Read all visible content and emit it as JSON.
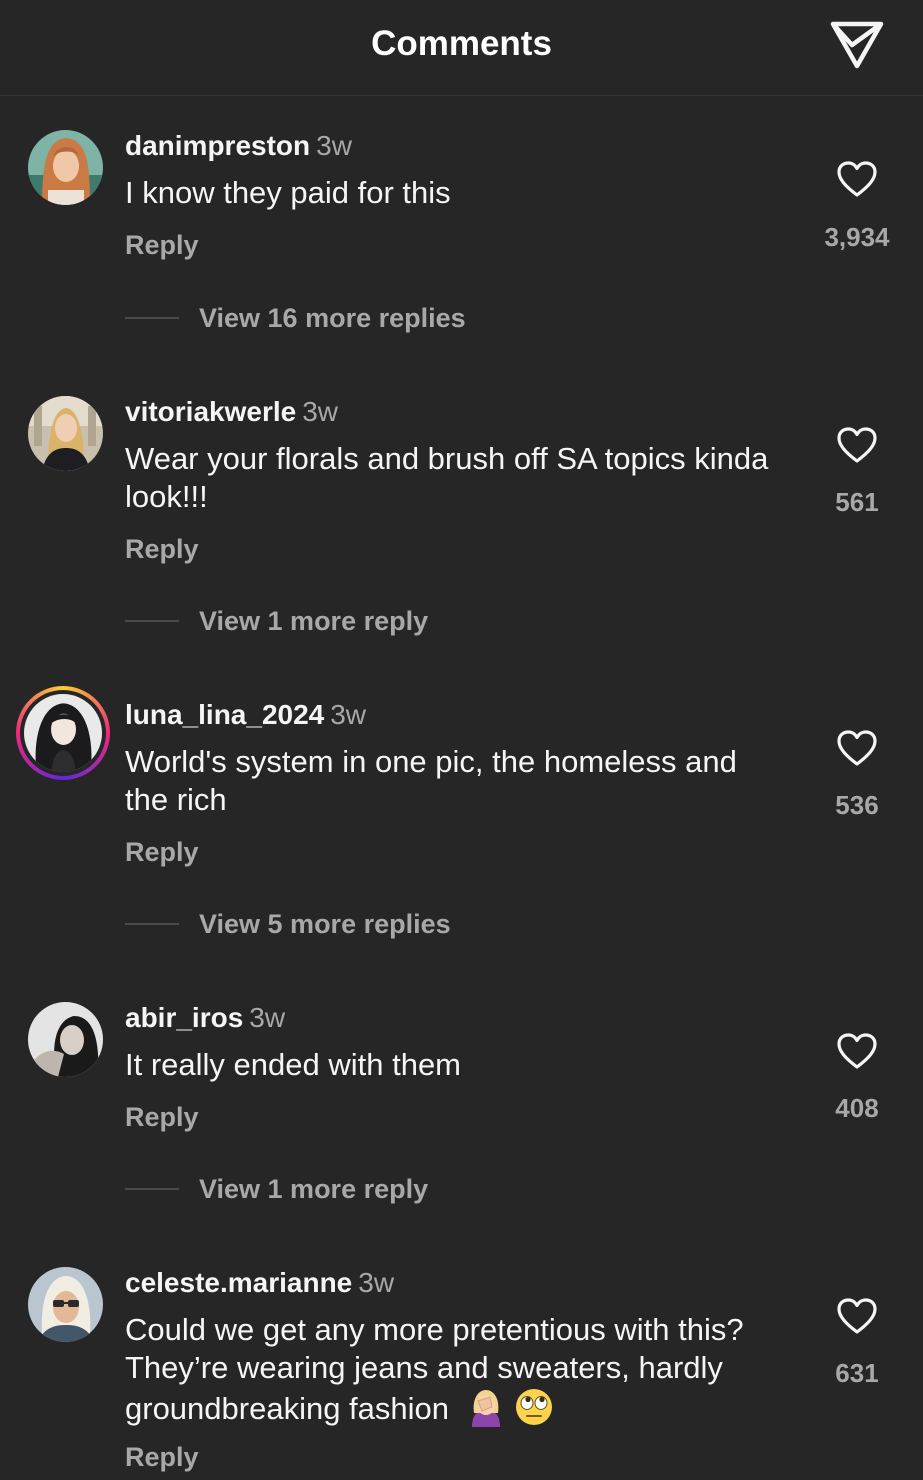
{
  "header": {
    "title": "Comments"
  },
  "comments": [
    {
      "username": "danimpreston",
      "time": "3w",
      "text": "I know they paid for this",
      "reply_label": "Reply",
      "likes": "3,934",
      "view_replies": "View 16 more replies"
    },
    {
      "username": "vitoriakwerle",
      "time": "3w",
      "text": "Wear your florals and brush off SA topics kinda look!!!",
      "reply_label": "Reply",
      "likes": "561",
      "view_replies": "View 1 more reply"
    },
    {
      "username": "luna_lina_2024",
      "time": "3w",
      "text": "World's system in one pic, the homeless and the rich",
      "reply_label": "Reply",
      "likes": "536",
      "view_replies": "View 5 more replies"
    },
    {
      "username": "abir_iros",
      "time": "3w",
      "text": "It really ended with them",
      "reply_label": "Reply",
      "likes": "408",
      "view_replies": "View 1 more reply"
    },
    {
      "username": "celeste.marianne",
      "time": "3w",
      "text": "Could we get any more pretentious with this?  They’re wearing jeans and sweaters, hardly groundbreaking fashion",
      "emojis": [
        "facepalm-emoji",
        "eye-roll-emoji"
      ],
      "reply_label": "Reply",
      "likes": "631"
    }
  ]
}
